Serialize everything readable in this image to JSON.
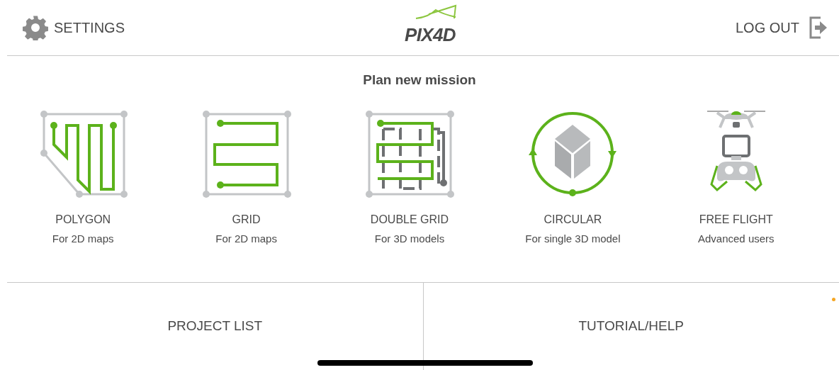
{
  "header": {
    "settings": "SETTINGS",
    "logo": "PIX4D",
    "logout": "LOG OUT"
  },
  "title": "Plan new mission",
  "missions": [
    {
      "kind": "polygon",
      "name": "POLYGON",
      "subtitle": "For 2D maps"
    },
    {
      "kind": "grid",
      "name": "GRID",
      "subtitle": "For 2D maps"
    },
    {
      "kind": "double_grid",
      "name": "DOUBLE GRID",
      "subtitle": "For 3D models"
    },
    {
      "kind": "circular",
      "name": "CIRCULAR",
      "subtitle": "For single 3D model"
    },
    {
      "kind": "free_flight",
      "name": "FREE FLIGHT",
      "subtitle": "Advanced users"
    }
  ],
  "footer": [
    "PROJECT LIST",
    "TUTORIAL/HELP"
  ]
}
